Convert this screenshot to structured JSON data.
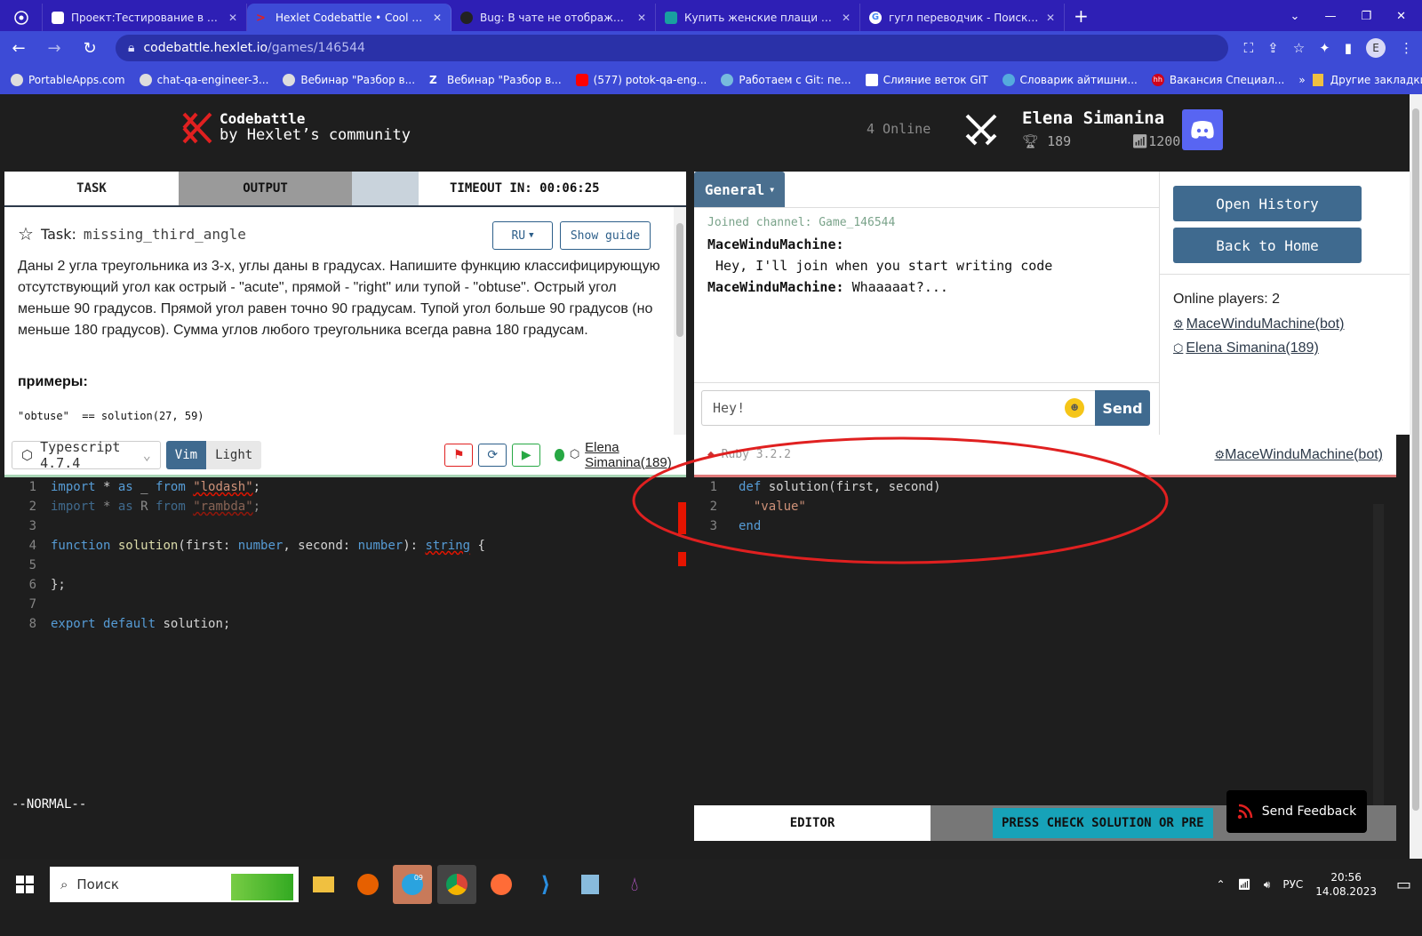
{
  "browser": {
    "tabs": [
      {
        "title": "Проект:Тестирование в продак",
        "fav_color": "#ffffff",
        "active": false
      },
      {
        "title": "Hexlet Codebattle • Cool game",
        "fav_color": "#e02020",
        "active": true
      },
      {
        "title": "Bug: В чате не отображаются сл",
        "fav_color": "#222222",
        "active": false
      },
      {
        "title": "Купить женские плащи и тренч",
        "fav_color": "#19a0a0",
        "active": false
      },
      {
        "title": "гугл переводчик - Поиск в Goo",
        "fav_color": "#ffffff",
        "active": false
      }
    ],
    "address": {
      "host": "codebattle.hexlet.io",
      "path": "/games/146544"
    },
    "profile_initial": "E",
    "bookmarks": [
      "PortableApps.com",
      "chat-qa-engineer-3...",
      "Вебинар \"Разбор в...",
      "Вебинар \"Разбор в...",
      "(577) potok-qa-eng...",
      "Работаем с Git: пе...",
      "Слияние веток GIT",
      "Словарик айтишни...",
      "Вакансия Специал..."
    ],
    "other_bookmarks": "Другие закладки"
  },
  "header": {
    "logo_line1": "Codebattle",
    "logo_line2": "by Hexlet’s community",
    "online": "4 Online",
    "user_name": "Elena Simanina",
    "user_score": "189",
    "user_rating": "1200"
  },
  "task_panel": {
    "tab_task": "TASK",
    "tab_output": "OUTPUT",
    "timeout": "TIMEOUT IN: 00:06:25",
    "task_label": "Task:",
    "task_name": "missing_third_angle",
    "lang_button": "RU",
    "guide_button": "Show guide",
    "description": "Даны 2 угла треугольника из 3-х, углы даны в градусах. Напишите функцию классифицирующую отсутствующий угол как острый - \"acute\", прямой - \"right\" или тупой - \"obtuse\". Острый угол меньше 90 градусов. Прямой угол равен точно 90 градусам. Тупой угол больше 90 градусов (но меньше 180 градусов). Сумма углов любого треугольника всегда равна 180 градусам.",
    "examples_title": "примеры:",
    "example_line": "\"obtuse\"  == solution(27, 59)"
  },
  "chat": {
    "channel": "General",
    "joined": "Joined channel: Game_146544",
    "messages": [
      {
        "author": "MaceWinduMachine:",
        "text": " Hey, I'll join when you start writing code"
      },
      {
        "author": "MaceWinduMachine:",
        "text": "Whaaaaat?..."
      }
    ],
    "input_value": "Hey!",
    "send_label": "Send"
  },
  "right_column": {
    "open_history": "Open History",
    "back_home": "Back to Home",
    "online_players_label": "Online players: 2",
    "players": [
      "MaceWinduMachine(bot)",
      "Elena Simanina(189)"
    ]
  },
  "left_editor": {
    "language": "Typescript 4.7.4",
    "vim_label": "Vim",
    "light_label": "Light",
    "player": "Elena Simanina(189)",
    "status": "--NORMAL--",
    "line_numbers": [
      "1",
      "2",
      "3",
      "4",
      "5",
      "6",
      "7",
      "8"
    ]
  },
  "right_editor": {
    "language": "Ruby 3.2.2",
    "player": "MaceWinduMachine(bot)",
    "line_numbers": [
      "1",
      "2",
      "3"
    ],
    "editor_tab": "EDITOR",
    "press_text": "PRESS CHECK SOLUTION OR PRE"
  },
  "feedback": "Send Feedback",
  "taskbar": {
    "search_placeholder": "Поиск",
    "language": "РУС",
    "time": "20:56",
    "date": "14.08.2023",
    "badge": "09"
  },
  "colors": {
    "accent": "#3f6a8f",
    "browser_frame": "#3d4bd6",
    "annotation": "#e02020"
  }
}
